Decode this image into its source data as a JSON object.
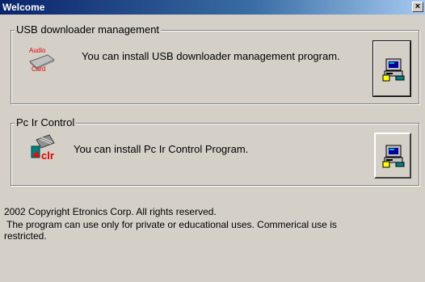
{
  "window": {
    "title": "Welcome",
    "close_label": "×"
  },
  "usb_group": {
    "title": "USB downloader management",
    "description": "You can install USB downloader management program.",
    "icon_text_top": "Audio",
    "icon_text_bottom": "Card"
  },
  "pcir_group": {
    "title": "Pc Ir Control",
    "description": "You can install Pc Ir Control Program.",
    "icon_text": "clr"
  },
  "footer": {
    "copyright": "2002 Copyright Etronics Corp. All rights reserved.",
    "notice_line1": "The program can use only for private or educational uses. Commerical use is",
    "notice_line2": "restricted."
  }
}
